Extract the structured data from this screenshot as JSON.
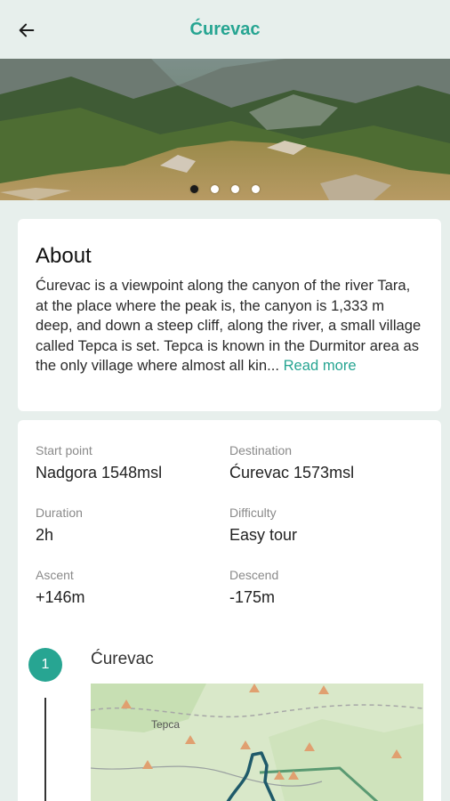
{
  "app_bar": {
    "title": "Ćurevac",
    "back_icon": "arrow-left-icon"
  },
  "gallery": {
    "slides": 4,
    "active_index": 0
  },
  "about": {
    "title": "About",
    "text": "Ćurevac is a viewpoint along the canyon of the river Tara, at the place where the peak is, the canyon is 1,333 m deep, and down a steep cliff, along the river, a small village called Tepca is set. Tepca is known in the Durmitor area as the only village where almost all kin...",
    "read_more": "Read more"
  },
  "details": {
    "start_point": {
      "label": "Start point",
      "value": "Nadgora 1548msl"
    },
    "destination": {
      "label": "Destination",
      "value": "Ćurevac 1573msl"
    },
    "duration": {
      "label": "Duration",
      "value": "2h"
    },
    "difficulty": {
      "label": "Difficulty",
      "value": "Easy tour"
    },
    "ascent": {
      "label": "Ascent",
      "value": "+146m"
    },
    "descend": {
      "label": "Descend",
      "value": "-175m"
    }
  },
  "route": {
    "step_number": "1",
    "step_name": "Ćurevac",
    "map_label": "Tepca"
  },
  "colors": {
    "accent": "#27a592",
    "background": "#e7efec",
    "card": "#ffffff"
  }
}
